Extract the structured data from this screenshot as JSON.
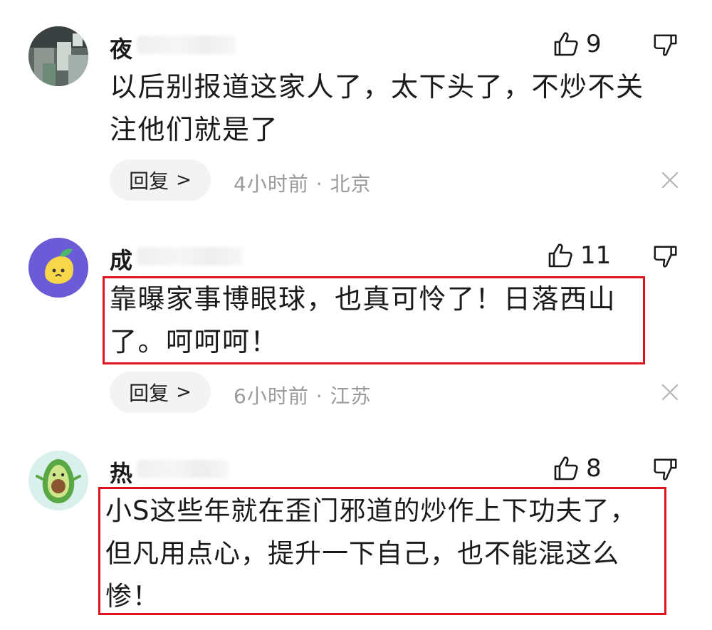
{
  "comments": [
    {
      "username": "夜",
      "likes": "9",
      "lines": [
        "以后别报道这家人了，太下头了，不炒不关",
        "注他们就是了"
      ],
      "reply_label": "回复",
      "time": "4小时前",
      "location": "北京",
      "avatar": "photo-avatar"
    },
    {
      "username": "成",
      "likes": "11",
      "lines": [
        "靠曝家事博眼球，也真可怜了！日落西山",
        "了。呵呵呵！"
      ],
      "reply_label": "回复",
      "time": "6小时前",
      "location": "江苏",
      "avatar": "lemon-avatar"
    },
    {
      "username": "热",
      "likes": "8",
      "lines": [
        "小S这些年就在歪门邪道的炒作上下功夫了，",
        "但凡用点心，提升一下自己，也不能混这么",
        "惨！"
      ],
      "avatar": "avocado-avatar"
    }
  ],
  "separator": "·",
  "colors": {
    "highlight": "#e0141e",
    "meta": "#9a9a9a",
    "reply_bg": "#f3f3f3"
  }
}
